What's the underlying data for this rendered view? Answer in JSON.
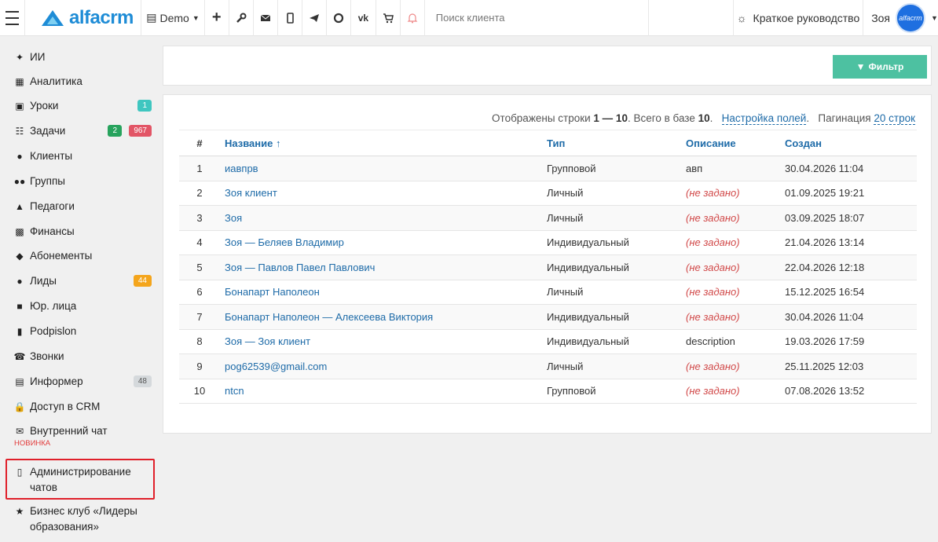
{
  "topbar": {
    "logo_text": "alfacrm",
    "branch": "Demo",
    "search_placeholder": "Поиск клиента",
    "guide": "Краткое руководство",
    "user_name": "Зоя",
    "avatar_text": "alfacrm"
  },
  "sidebar": {
    "items": [
      {
        "label": "ИИ",
        "icon": "sparkles-icon"
      },
      {
        "label": "Аналитика",
        "icon": "map-icon"
      },
      {
        "label": "Уроки",
        "icon": "calendar-icon",
        "badges": [
          "1"
        ]
      },
      {
        "label": "Задачи",
        "icon": "clipboard-icon",
        "badges": [
          "2",
          "967"
        ]
      },
      {
        "label": "Клиенты",
        "icon": "user-icon"
      },
      {
        "label": "Группы",
        "icon": "users-icon"
      },
      {
        "label": "Педагоги",
        "icon": "graduation-cap-icon"
      },
      {
        "label": "Финансы",
        "icon": "money-icon"
      },
      {
        "label": "Абонементы",
        "icon": "tags-icon"
      },
      {
        "label": "Лиды",
        "icon": "user-plus-icon",
        "badges": [
          "44"
        ]
      },
      {
        "label": "Юр. лица",
        "icon": "briefcase-icon"
      },
      {
        "label": "Podpislon",
        "icon": "file-icon"
      },
      {
        "label": "Звонки",
        "icon": "phone-icon"
      },
      {
        "label": "Информер",
        "icon": "newspaper-icon",
        "badges": [
          "48"
        ]
      },
      {
        "label": "Доступ в CRM",
        "icon": "lock-icon"
      },
      {
        "label": "Внутренний чат",
        "icon": "envelope-icon",
        "note": "НОВИНКА"
      },
      {
        "label": "Администрирование чатов",
        "icon": "comments-icon"
      },
      {
        "label": "Бизнес клуб «Лидеры образования»",
        "icon": "star-icon"
      }
    ]
  },
  "filter_button": "Фильтр",
  "summary": {
    "prefix": "Отображены строки ",
    "range": "1 — 10",
    "mid": ". Всего в базе ",
    "total": "10",
    "end": ".",
    "settings_link": "Настройка полей",
    "pagination_label": "Пагинация",
    "pagination_link": "20 строк"
  },
  "table": {
    "headers": [
      "#",
      "Название ↑",
      "Тип",
      "Описание",
      "Создан"
    ],
    "rows": [
      {
        "n": "1",
        "name": "иавпрв",
        "type": "Групповой",
        "desc": "авп",
        "created": "30.04.2026 11:04"
      },
      {
        "n": "2",
        "name": "Зоя клиент",
        "type": "Личный",
        "desc": "(не задано)",
        "created": "01.09.2025 19:21"
      },
      {
        "n": "3",
        "name": "Зоя",
        "type": "Личный",
        "desc": "(не задано)",
        "created": "03.09.2025 18:07"
      },
      {
        "n": "4",
        "name": "Зоя — Беляев Владимир",
        "type": "Индивидуальный",
        "desc": "(не задано)",
        "created": "21.04.2026 13:14"
      },
      {
        "n": "5",
        "name": "Зоя — Павлов Павел Павлович",
        "type": "Индивидуальный",
        "desc": "(не задано)",
        "created": "22.04.2026 12:18"
      },
      {
        "n": "6",
        "name": "Бонапарт Наполеон",
        "type": "Личный",
        "desc": "(не задано)",
        "created": "15.12.2025 16:54"
      },
      {
        "n": "7",
        "name": "Бонапарт Наполеон — Алексеева Виктория",
        "type": "Индивидуальный",
        "desc": "(не задано)",
        "created": "30.04.2026 11:04"
      },
      {
        "n": "8",
        "name": "Зоя — Зоя клиент",
        "type": "Индивидуальный",
        "desc": "description",
        "created": "19.03.2026 17:59"
      },
      {
        "n": "9",
        "name": "pog62539@gmail.com",
        "type": "Личный",
        "desc": "(не задано)",
        "created": "25.11.2025 12:03"
      },
      {
        "n": "10",
        "name": "ntcn",
        "type": "Групповой",
        "desc": "(не задано)",
        "created": "07.08.2026 13:52"
      }
    ]
  }
}
